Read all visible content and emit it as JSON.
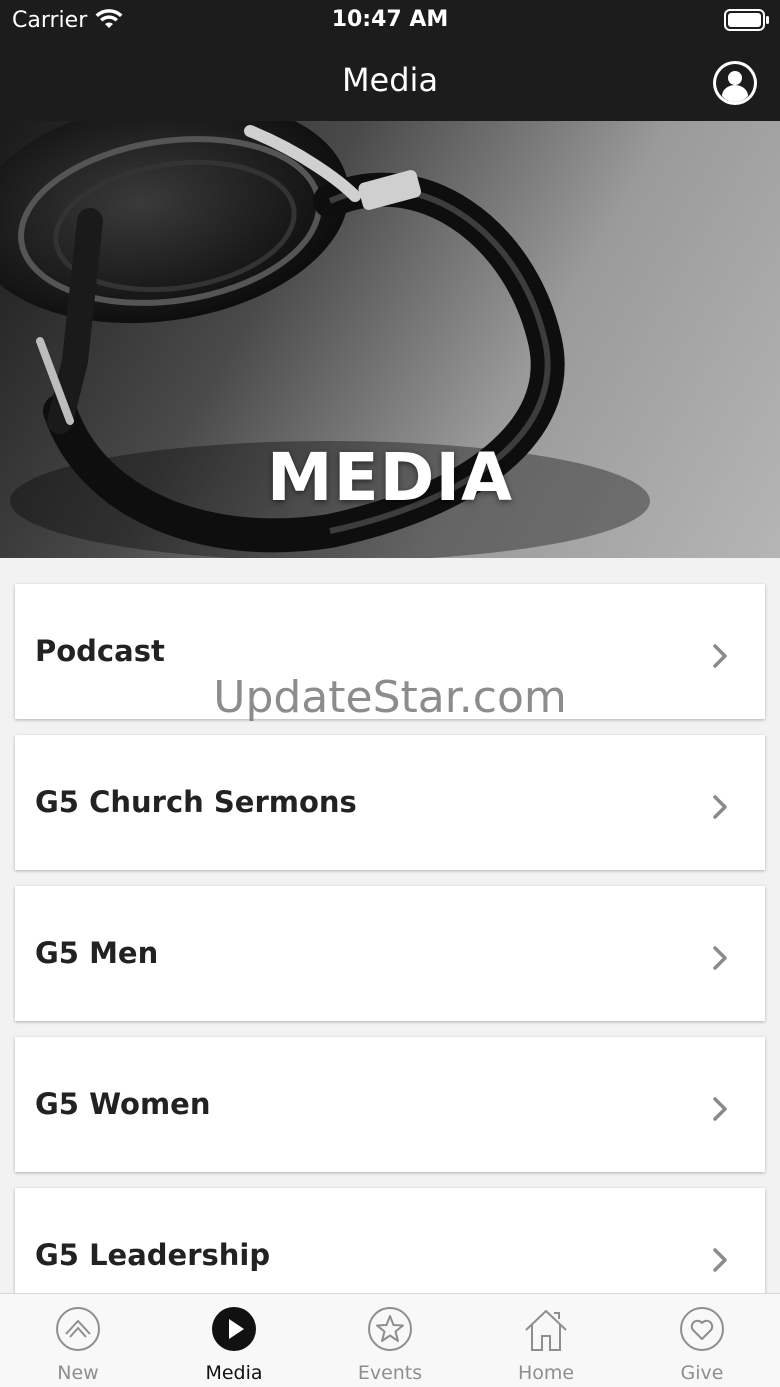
{
  "status_bar": {
    "carrier": "Carrier",
    "time": "10:47 AM"
  },
  "nav": {
    "title": "Media",
    "profile_icon": "profile-icon"
  },
  "hero": {
    "text": "MEDIA",
    "image": "headphones"
  },
  "list": {
    "items": [
      {
        "label": "Podcast"
      },
      {
        "label": "G5 Church Sermons"
      },
      {
        "label": "G5 Men"
      },
      {
        "label": "G5 Women"
      },
      {
        "label": "G5 Leadership"
      }
    ]
  },
  "watermark": "UpdateStar.com",
  "tabs": [
    {
      "label": "New",
      "icon": "chevron-up-icon"
    },
    {
      "label": "Media",
      "icon": "play-icon",
      "active": true
    },
    {
      "label": "Events",
      "icon": "star-icon"
    },
    {
      "label": "Home",
      "icon": "home-icon"
    },
    {
      "label": "Give",
      "icon": "heart-icon"
    }
  ],
  "colors": {
    "bar": "#1c1c1c",
    "background": "#f2f2f2",
    "tab_inactive": "#8e8e8e",
    "tab_active": "#111111"
  }
}
